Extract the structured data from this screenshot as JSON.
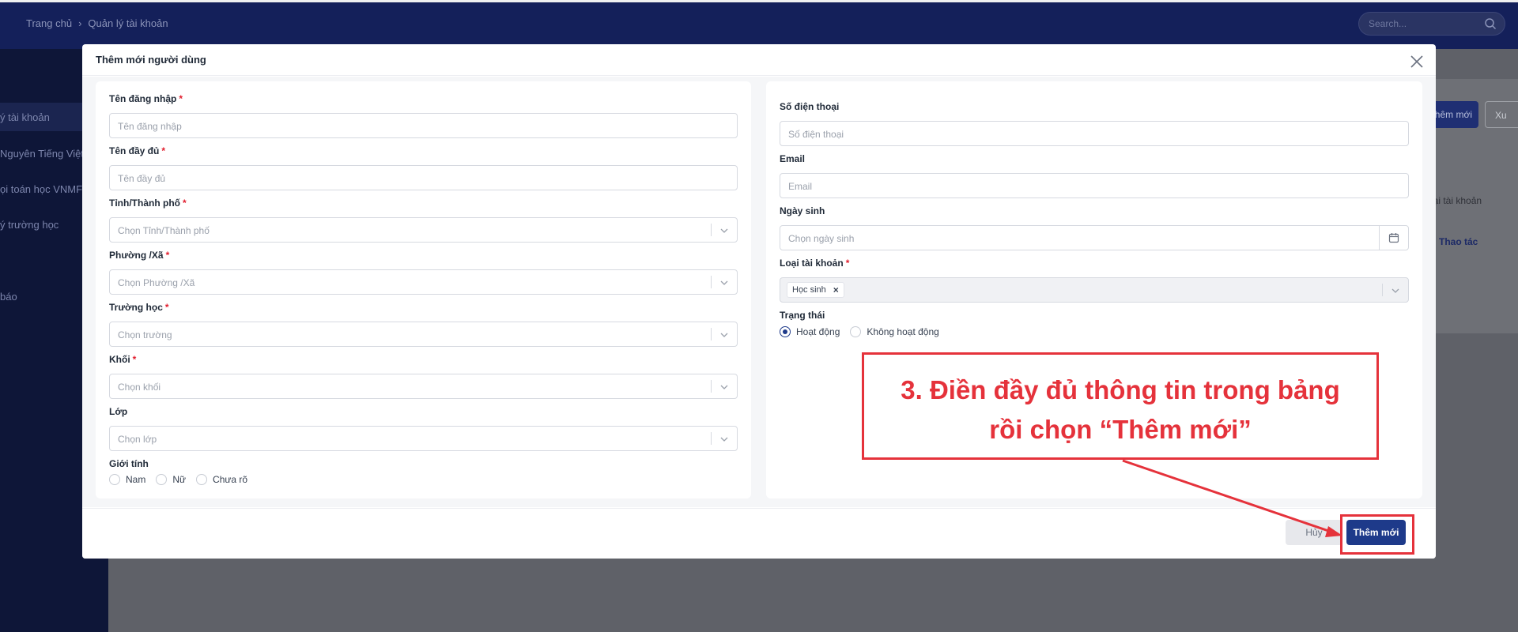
{
  "background": {
    "breadcrumb": [
      "Trang chủ",
      "›",
      "Quản lý tài khoản"
    ],
    "search_placeholder": "Search...",
    "sidebar_items": [
      {
        "label": "ý tài khoản",
        "active": true
      },
      {
        "label": "Nguyên Tiếng Việt",
        "active": false
      },
      {
        "label": "ọi toán học VNMF",
        "active": false
      },
      {
        "label": "ý trường học",
        "active": false
      },
      {
        "label": "báo",
        "active": false
      }
    ],
    "add_button": "hêm mới",
    "export_button": "Xu",
    "column_header": "oại tài khoản",
    "action_header": "Thao tác"
  },
  "modal": {
    "title": "Thêm mới người dùng",
    "left": {
      "username": {
        "label": "Tên đăng nhập",
        "required": "*",
        "placeholder": "Tên đăng nhập"
      },
      "fullname": {
        "label": "Tên đầy đủ",
        "required": "*",
        "placeholder": "Tên đầy đủ"
      },
      "province": {
        "label": "Tỉnh/Thành phố",
        "required": "*",
        "placeholder": "Chọn Tỉnh/Thành phố"
      },
      "ward": {
        "label": "Phường /Xã",
        "required": "*",
        "placeholder": "Chọn Phường /Xã"
      },
      "school": {
        "label": "Trường học",
        "required": "*",
        "placeholder": "Chọn trường"
      },
      "grade": {
        "label": "Khối",
        "required": "*",
        "placeholder": "Chọn khối"
      },
      "class": {
        "label": "Lớp",
        "placeholder": "Chọn lớp"
      },
      "gender": {
        "label": "Giới tính",
        "options": [
          "Nam",
          "Nữ",
          "Chưa rõ"
        ]
      }
    },
    "right": {
      "phone": {
        "label": "Số điện thoại",
        "placeholder": "Số điện thoại"
      },
      "email": {
        "label": "Email",
        "placeholder": "Email"
      },
      "birthday": {
        "label": "Ngày sinh",
        "placeholder": "Chọn ngày sinh"
      },
      "account_type": {
        "label": "Loại tài khoản",
        "required": "*",
        "selected_tag": "Học sinh",
        "tag_remove": "×"
      },
      "status": {
        "label": "Trạng thái",
        "options": [
          "Hoạt động",
          "Không hoạt động"
        ],
        "selected": "Hoạt động"
      }
    },
    "footer": {
      "cancel": "Hủy",
      "submit": "Thêm mới"
    }
  },
  "annotation": {
    "line1": "3. Điền đầy đủ thông tin trong bảng",
    "line2": "rồi chọn “Thêm mới”",
    "color": "#e5323b"
  },
  "colors": {
    "primary": "#1e3a8a",
    "required": "#e11d2d",
    "sidebar": "#0e1638"
  }
}
